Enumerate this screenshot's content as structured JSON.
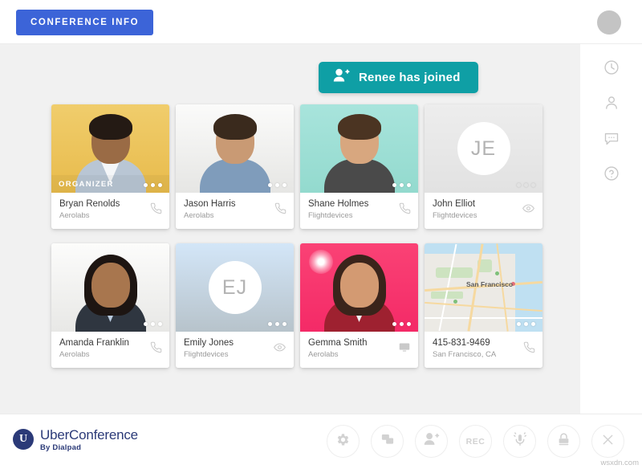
{
  "topbar": {
    "conference_info_label": "CONFERENCE INFO",
    "avatar_icon": "user-avatar-icon"
  },
  "notification": {
    "icon": "add-person-icon",
    "text": "Renee has joined",
    "color": "#0f9fa5"
  },
  "participants": [
    {
      "name": "Bryan Renolds",
      "org": "Aerolabs",
      "badge": "ORGANIZER",
      "media_type": "photo",
      "bg": "#eec45c",
      "action_icon": "phone-icon",
      "speaking": false,
      "initials": ""
    },
    {
      "name": "Jason Harris",
      "org": "Aerolabs",
      "badge": "",
      "media_type": "photo",
      "bg": "#f0f0ee",
      "action_icon": "phone-icon",
      "speaking": false,
      "initials": ""
    },
    {
      "name": "Shane Holmes",
      "org": "Flightdevices",
      "badge": "",
      "media_type": "photo",
      "bg": "#9fe0d8",
      "action_icon": "phone-icon",
      "speaking": false,
      "initials": ""
    },
    {
      "name": "John Elliot",
      "org": "Flightdevices",
      "badge": "",
      "media_type": "initials",
      "bg": "#ebebeb",
      "action_icon": "eye-icon",
      "speaking": false,
      "initials": "JE"
    },
    {
      "name": "Amanda Franklin",
      "org": "Aerolabs",
      "badge": "",
      "media_type": "photo",
      "bg": "#f2f2f0",
      "action_icon": "phone-icon",
      "speaking": false,
      "initials": ""
    },
    {
      "name": "Emily Jones",
      "org": "Flightdevices",
      "badge": "",
      "media_type": "initials",
      "bg": "#cfe2f5",
      "action_icon": "eye-icon",
      "speaking": false,
      "initials": "EJ"
    },
    {
      "name": "Gemma Smith",
      "org": "Aerolabs",
      "badge": "",
      "media_type": "photo",
      "bg": "#f7386e",
      "action_icon": "screen-icon",
      "speaking": true,
      "initials": ""
    },
    {
      "name": "415-831-9469",
      "org": "San Francisco, CA",
      "badge": "",
      "media_type": "map",
      "bg": "#eceae5",
      "action_icon": "phone-icon",
      "speaking": false,
      "initials": "",
      "map_label": "San Francisco"
    }
  ],
  "sidebar": {
    "items": [
      {
        "icon": "clock-icon",
        "label": "History"
      },
      {
        "icon": "person-icon",
        "label": "Participants"
      },
      {
        "icon": "chat-icon",
        "label": "Chat"
      },
      {
        "icon": "help-icon",
        "label": "Help"
      }
    ]
  },
  "bottombar": {
    "brand_mark": "U",
    "brand_name": "UberConference",
    "brand_sub": "By Dialpad",
    "tools": [
      {
        "icon": "gear-icon",
        "label": "Settings"
      },
      {
        "icon": "screen-share-icon",
        "label": "Share screen"
      },
      {
        "icon": "add-person-icon",
        "label": "Add participant"
      },
      {
        "icon": "rec-icon",
        "label": "REC"
      },
      {
        "icon": "microphone-icon",
        "label": "Mute"
      },
      {
        "icon": "lock-icon",
        "label": "Lock conference"
      },
      {
        "icon": "close-icon",
        "label": "End call"
      }
    ]
  },
  "watermark": "wsxdn.com"
}
